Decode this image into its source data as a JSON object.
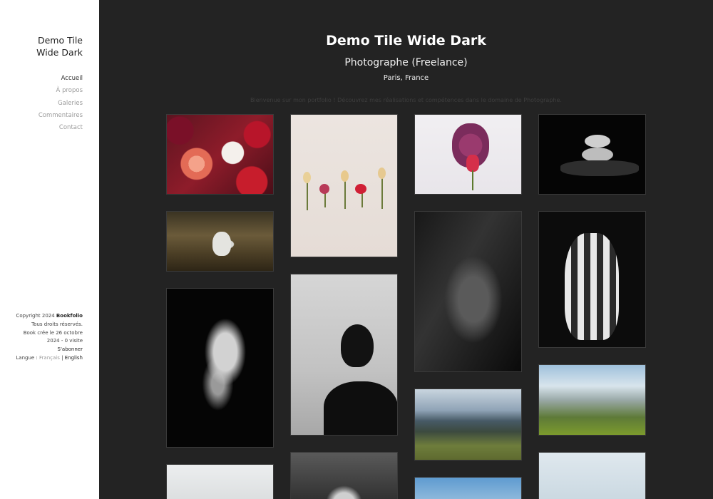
{
  "site": {
    "title_line1": "Demo Tile",
    "title_line2": "Wide Dark"
  },
  "nav": [
    {
      "label": "Accueil",
      "active": true
    },
    {
      "label": "À propos"
    },
    {
      "label": "Galeries"
    },
    {
      "label": "Commentaires"
    },
    {
      "label": "Contact"
    }
  ],
  "footer": {
    "copyright": "Copyright 2024",
    "brand": "Bookfolio",
    "rights": "Tous droits réservés.",
    "created": "Book crée le 26 octobre",
    "visits": "2024 - 0 visite",
    "subscribe": "S'abonner",
    "lang_label": "Langue :",
    "lang_fr": "Français",
    "lang_sep": "|",
    "lang_en": "English"
  },
  "hero": {
    "title": "Demo Tile Wide Dark",
    "subtitle": "Photographe (Freelance)",
    "location": "Paris, France",
    "intro": "Bienvenue sur mon portfolio ! Découvrez mes réalisations et compétences dans le domaine de Photographe."
  },
  "gallery": [
    {
      "subject": "pink gerbera and red flowers bouquet"
    },
    {
      "subject": "four dried flowers on beige background"
    },
    {
      "subject": "purple lilac with red tulip"
    },
    {
      "subject": "stacked stones on black background"
    },
    {
      "subject": "white rabbit in grass"
    },
    {
      "subject": "black and white contortionist"
    },
    {
      "subject": "woman silhouette profile"
    },
    {
      "subject": "face with light shadows"
    },
    {
      "subject": "man with white face paint stripes"
    },
    {
      "subject": "rocky mountain valley"
    },
    {
      "subject": "green mountains and clouds"
    },
    {
      "subject": "foggy landscape"
    },
    {
      "subject": "elderly woman portrait"
    },
    {
      "subject": "blue sky with clouds"
    },
    {
      "subject": "pale sky"
    }
  ]
}
